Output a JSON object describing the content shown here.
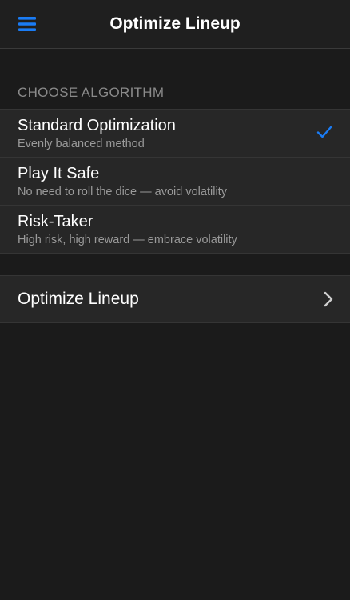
{
  "header": {
    "title": "Optimize Lineup",
    "menu_icon": "hamburger-menu-icon",
    "accent_color": "#1a7cf5"
  },
  "algorithms": {
    "section_label": "CHOOSE ALGORITHM",
    "selected_index": 0,
    "items": [
      {
        "title": "Standard Optimization",
        "subtitle": "Evenly balanced method",
        "selected": true
      },
      {
        "title": "Play It Safe",
        "subtitle": "No need to roll the dice — avoid volatility",
        "selected": false
      },
      {
        "title": "Risk-Taker",
        "subtitle": "High risk, high reward — embrace volatility",
        "selected": false
      }
    ]
  },
  "action": {
    "label": "Optimize Lineup",
    "icon": "chevron-right-icon"
  }
}
